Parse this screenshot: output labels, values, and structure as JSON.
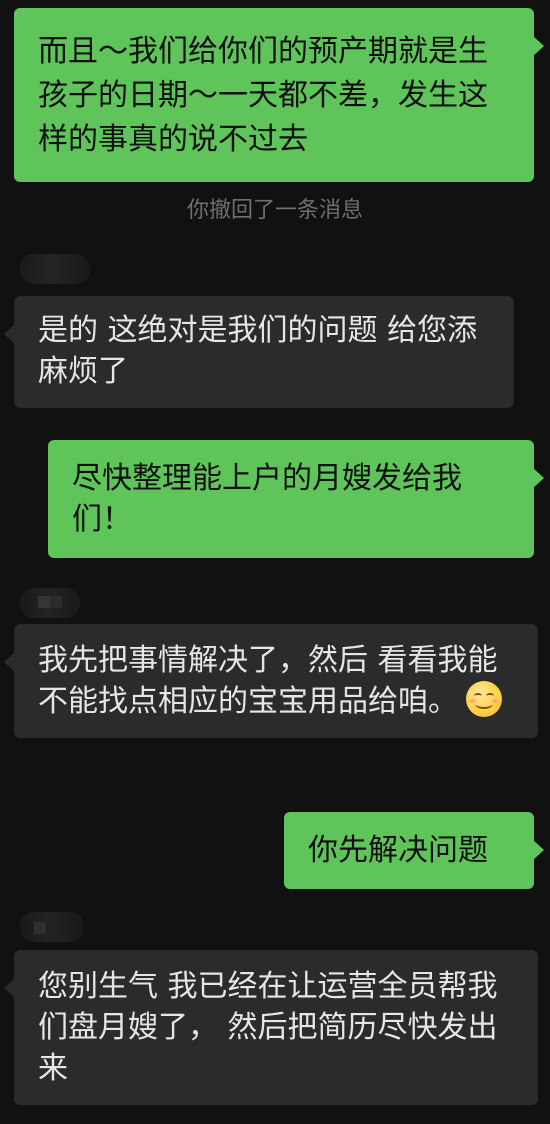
{
  "messages": [
    {
      "side": "sent",
      "text": "而且～我们给你们的预产期就是生孩子的日期～一天都不差，发生这样的事真的说不过去"
    },
    {
      "side": "system",
      "text": "你撤回了一条消息"
    },
    {
      "side": "recv",
      "text": "是的 这绝对是我们的问题 给您添麻烦了"
    },
    {
      "side": "sent",
      "text": "尽快整理能上户的月嫂发给我们！"
    },
    {
      "side": "recv",
      "text": "我先把事情解决了，然后 看看我能不能找点相应的宝宝用品给咱。",
      "emoji": "smiling-face-emoji"
    },
    {
      "side": "sent",
      "text": "你先解决问题"
    },
    {
      "side": "recv",
      "text": "您别生气 我已经在让运营全员帮我们盘月嫂了， 然后把简历尽快发出来"
    }
  ],
  "colors": {
    "background": "#111111",
    "sent_bubble": "#5fc55a",
    "received_bubble": "#2b2b2b",
    "system_text": "#6f6f6f"
  }
}
